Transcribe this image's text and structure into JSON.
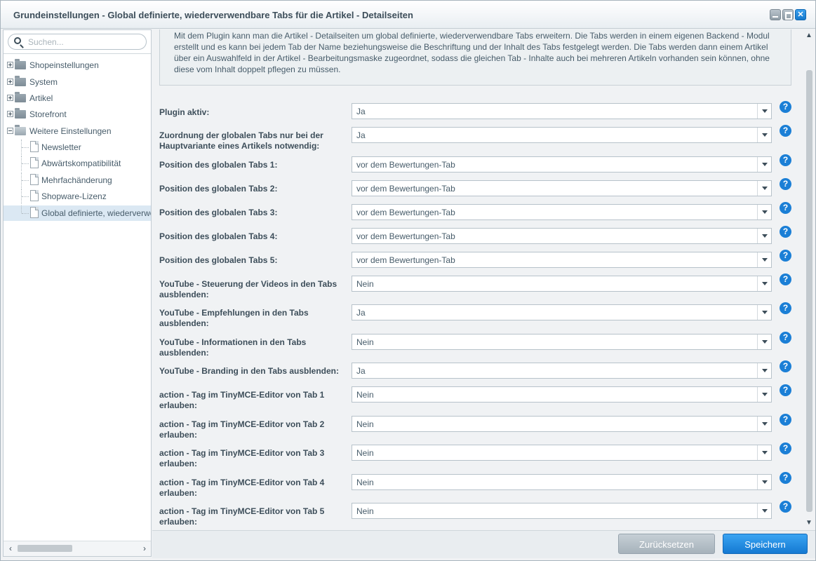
{
  "window": {
    "title": "Grundeinstellungen - Global definierte, wiederverwendbare Tabs für die Artikel - Detailseiten"
  },
  "sidebar": {
    "search_placeholder": "Suchen...",
    "items": [
      {
        "label": "Shopeinstellungen"
      },
      {
        "label": "System"
      },
      {
        "label": "Artikel"
      },
      {
        "label": "Storefront"
      },
      {
        "label": "Weitere Einstellungen"
      }
    ],
    "children": [
      {
        "label": "Newsletter"
      },
      {
        "label": "Abwärtskompatibilität"
      },
      {
        "label": "Mehrfachänderung"
      },
      {
        "label": "Shopware-Lizenz"
      },
      {
        "label": "Global definierte, wiederverwendbare Tabs"
      }
    ]
  },
  "description": "Mit dem Plugin kann man die Artikel - Detailseiten um global definierte, wiederverwendbare Tabs erweitern. Die Tabs werden in einem eigenen Backend - Modul erstellt und es kann bei jedem Tab der Name beziehungsweise die Beschriftung und der Inhalt des Tabs festgelegt werden. Die Tabs werden dann einem Artikel über ein Auswahlfeld in der Artikel - Bearbeitungsmaske zugeordnet, sodass die gleichen Tab - Inhalte auch bei mehreren Artikeln vorhanden sein können, ohne diese vom Inhalt doppelt pflegen zu müssen.",
  "fields": [
    {
      "label": "Plugin aktiv:",
      "value": "Ja"
    },
    {
      "label": "Zuordnung der globalen Tabs nur bei der Hauptvariante eines Artikels notwendig:",
      "value": "Ja"
    },
    {
      "label": "Position des globalen Tabs 1:",
      "value": "vor dem Bewertungen-Tab"
    },
    {
      "label": "Position des globalen Tabs 2:",
      "value": "vor dem Bewertungen-Tab"
    },
    {
      "label": "Position des globalen Tabs 3:",
      "value": "vor dem Bewertungen-Tab"
    },
    {
      "label": "Position des globalen Tabs 4:",
      "value": "vor dem Bewertungen-Tab"
    },
    {
      "label": "Position des globalen Tabs 5:",
      "value": "vor dem Bewertungen-Tab"
    },
    {
      "label": "YouTube - Steuerung der Videos in den Tabs ausblenden:",
      "value": "Nein"
    },
    {
      "label": "YouTube - Empfehlungen in den Tabs ausblenden:",
      "value": "Ja"
    },
    {
      "label": "YouTube - Informationen in den Tabs ausblenden:",
      "value": "Nein"
    },
    {
      "label": "YouTube - Branding in den Tabs ausblenden:",
      "value": "Ja"
    },
    {
      "label": "action - Tag im TinyMCE-Editor von Tab 1 erlauben:",
      "value": "Nein"
    },
    {
      "label": "action - Tag im TinyMCE-Editor von Tab 2 erlauben:",
      "value": "Nein"
    },
    {
      "label": "action - Tag im TinyMCE-Editor von Tab 3 erlauben:",
      "value": "Nein"
    },
    {
      "label": "action - Tag im TinyMCE-Editor von Tab 4 erlauben:",
      "value": "Nein"
    },
    {
      "label": "action - Tag im TinyMCE-Editor von Tab 5 erlauben:",
      "value": "Nein"
    }
  ],
  "help_glyph": "?",
  "footer": {
    "reset_label": "Zurücksetzen",
    "save_label": "Speichern"
  },
  "icons": [
    "search-icon",
    "folder-icon",
    "page-icon",
    "help-icon",
    "dropdown-arrow-icon"
  ],
  "colors": {
    "accent": "#1b7fd6",
    "save_button": "#1b86dd",
    "reset_button": "#b3bec6"
  }
}
